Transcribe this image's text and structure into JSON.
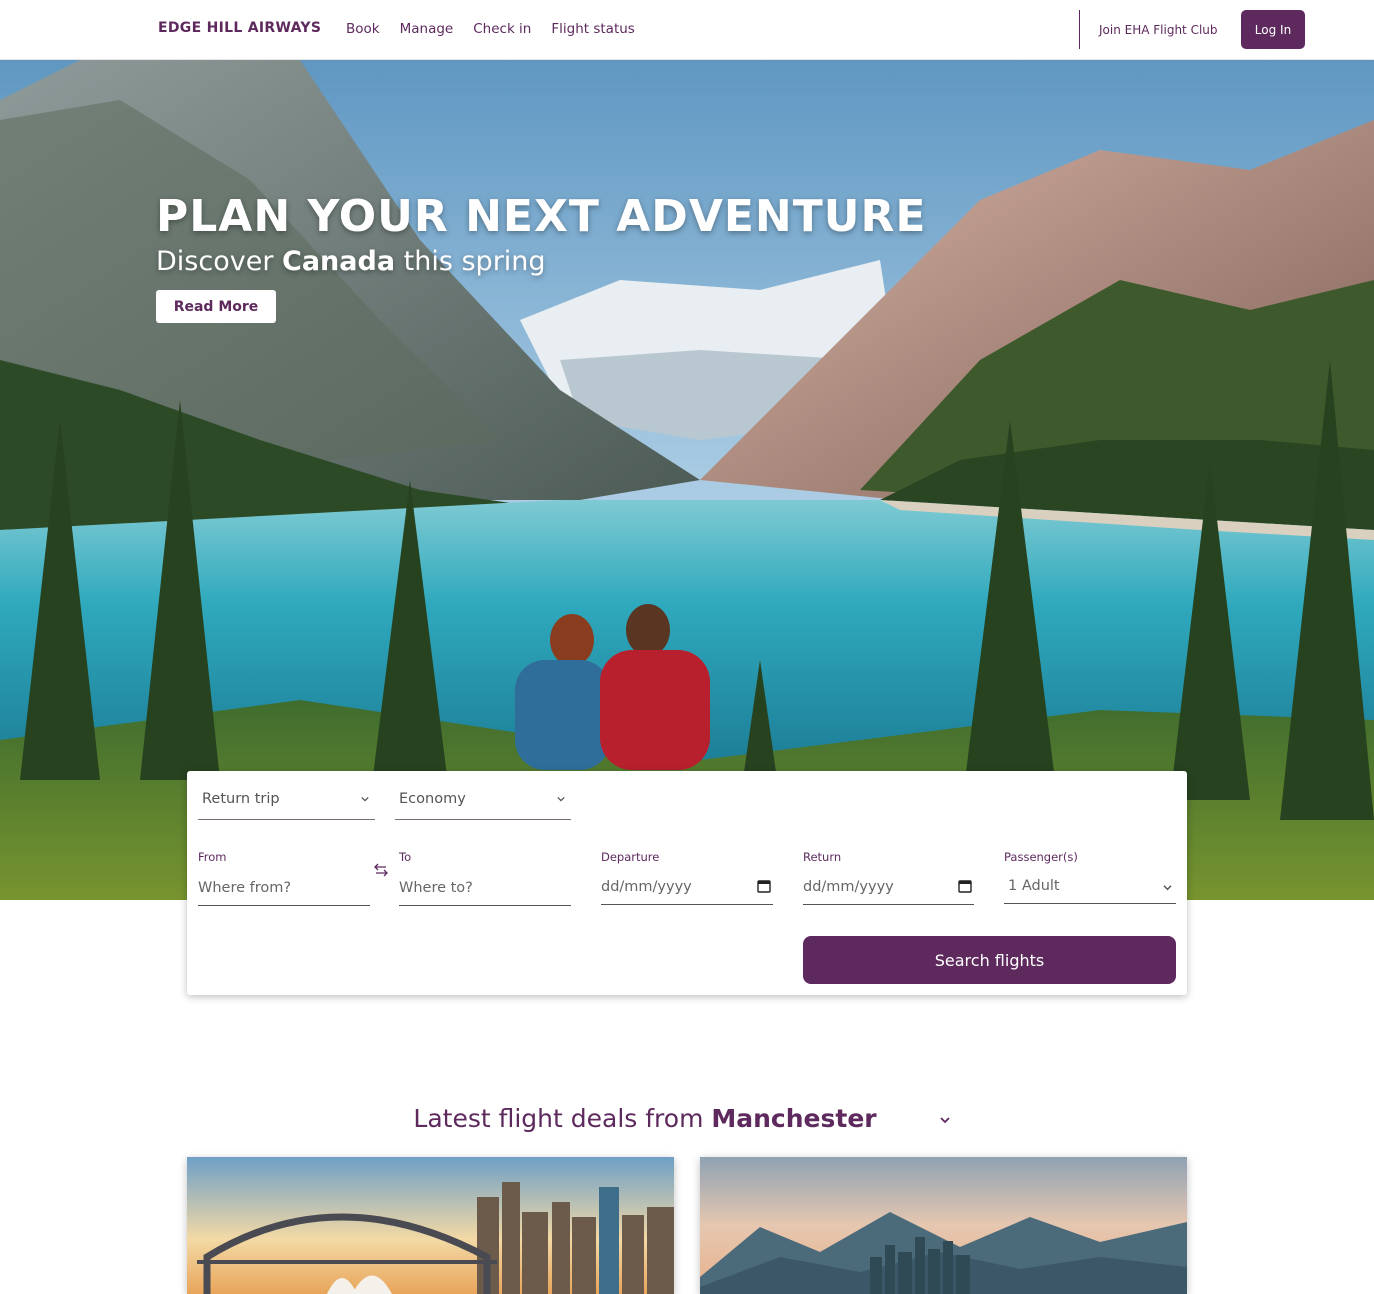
{
  "header": {
    "brand": "EDGE HILL AIRWAYS",
    "nav": [
      "Book",
      "Manage",
      "Check in",
      "Flight status"
    ],
    "join_label": "Join EHA Flight Club",
    "login_label": "Log In"
  },
  "hero": {
    "title": "PLAN YOUR NEXT ADVENTURE",
    "subtitle_prefix": "Discover",
    "subtitle_highlight": "Canada",
    "subtitle_suffix": "this spring",
    "button": "Read More"
  },
  "search": {
    "trip_type": "Return trip",
    "cabin_class": "Economy",
    "from_label": "From",
    "from_placeholder": "Where from?",
    "to_label": "To",
    "to_placeholder": "Where to?",
    "departure_label": "Departure",
    "departure_placeholder": "dd/mm/yyyy",
    "return_label": "Return",
    "return_placeholder": "dd/mm/yyyy",
    "passengers_label": "Passenger(s)",
    "passengers_value": "1 Adult",
    "button": "Search flights"
  },
  "deals": {
    "title_prefix": "Latest flight deals from",
    "origin": "Manchester"
  },
  "colors": {
    "brand": "#5e2a5e",
    "white": "#ffffff"
  },
  "icons": {
    "swap": "swap-arrows-icon",
    "calendar": "calendar-icon",
    "chevron": "chevron-down-icon"
  }
}
